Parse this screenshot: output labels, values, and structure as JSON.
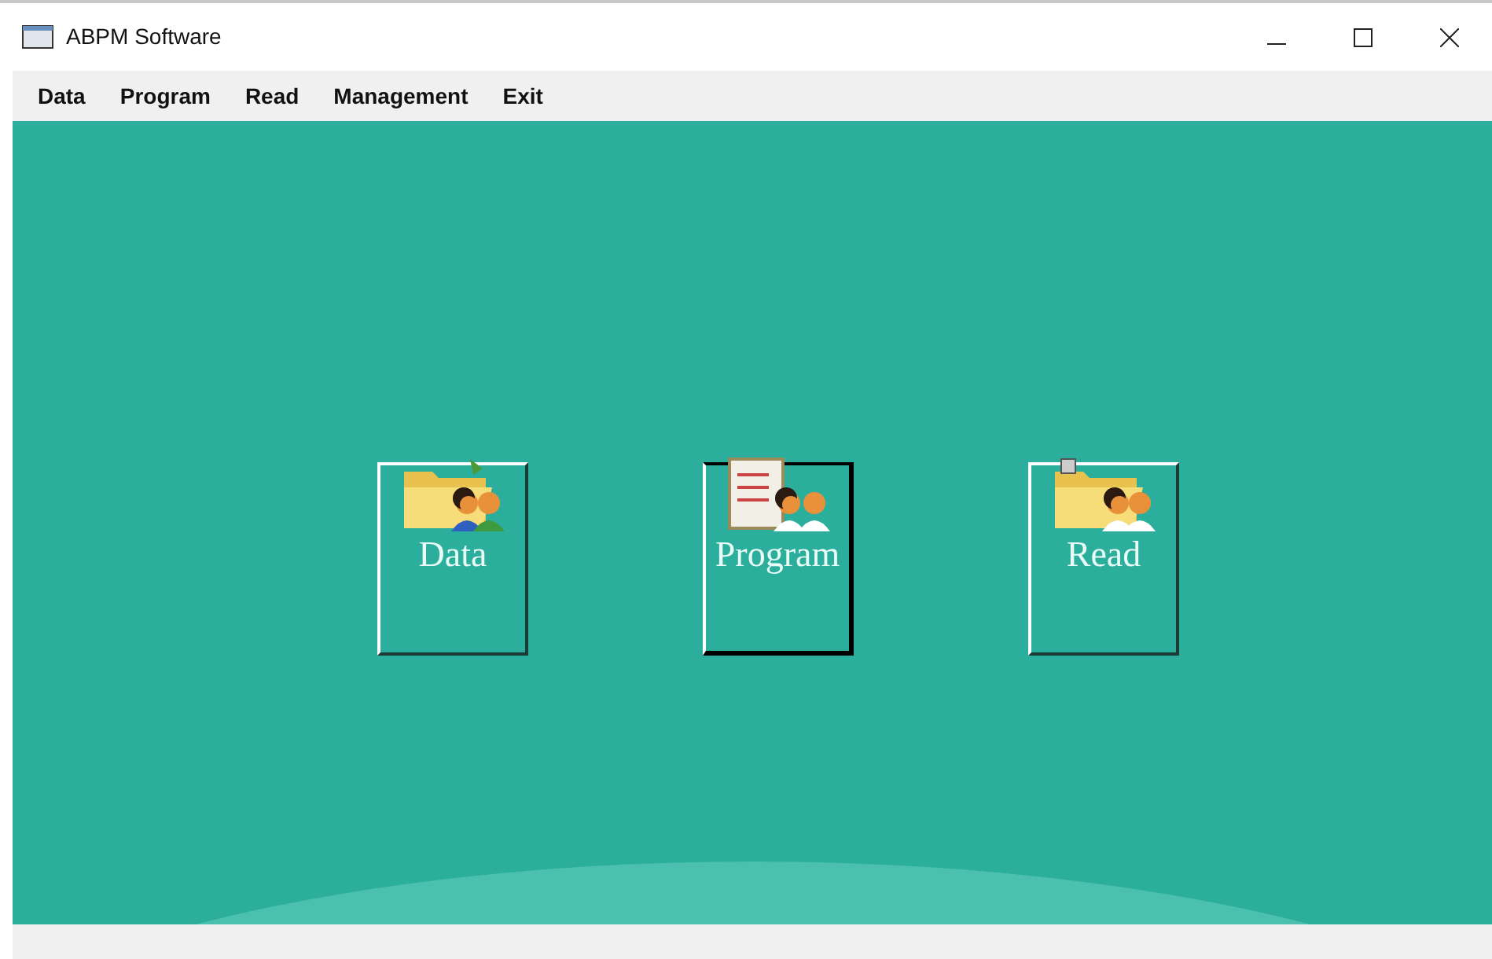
{
  "window": {
    "title": "ABPM Software"
  },
  "menu": [
    "Data",
    "Program",
    "Read",
    "Management",
    "Exit"
  ],
  "tiles": [
    {
      "label": "Data",
      "kind": "folder-people",
      "selected": false
    },
    {
      "label": "Program",
      "kind": "clipboard-doctors",
      "selected": true
    },
    {
      "label": "Read",
      "kind": "locked-folder",
      "selected": false
    }
  ]
}
